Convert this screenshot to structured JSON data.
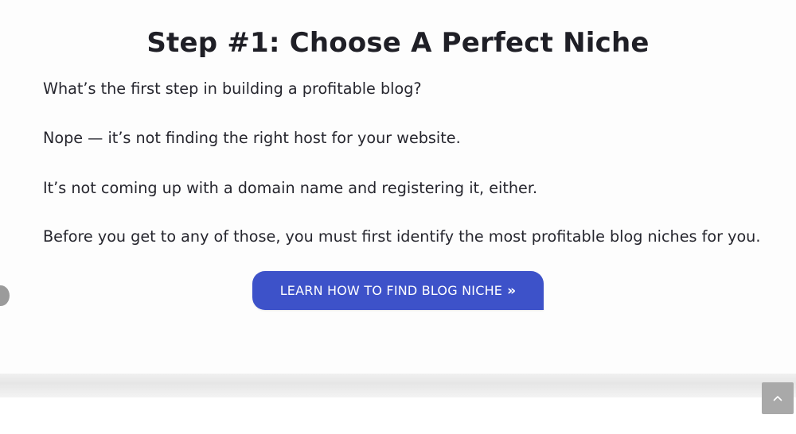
{
  "article": {
    "heading": "Step #1: Choose A Perfect Niche",
    "paragraphs": [
      "What’s the first step in building a profitable blog?",
      "Nope — it’s not finding the right host for your website.",
      "It’s not coming up with a domain name and registering it, either.",
      "Before you get to any of those, you must first identify the most profitable blog niches for you."
    ]
  },
  "cta": {
    "label": "LEARN HOW TO FIND BLOG NICHE",
    "icon": "double-chevron-right-icon",
    "color": "#3d52c9"
  },
  "scroll_to_top": {
    "icon": "chevron-up-icon",
    "color": "#a9a9a9"
  }
}
